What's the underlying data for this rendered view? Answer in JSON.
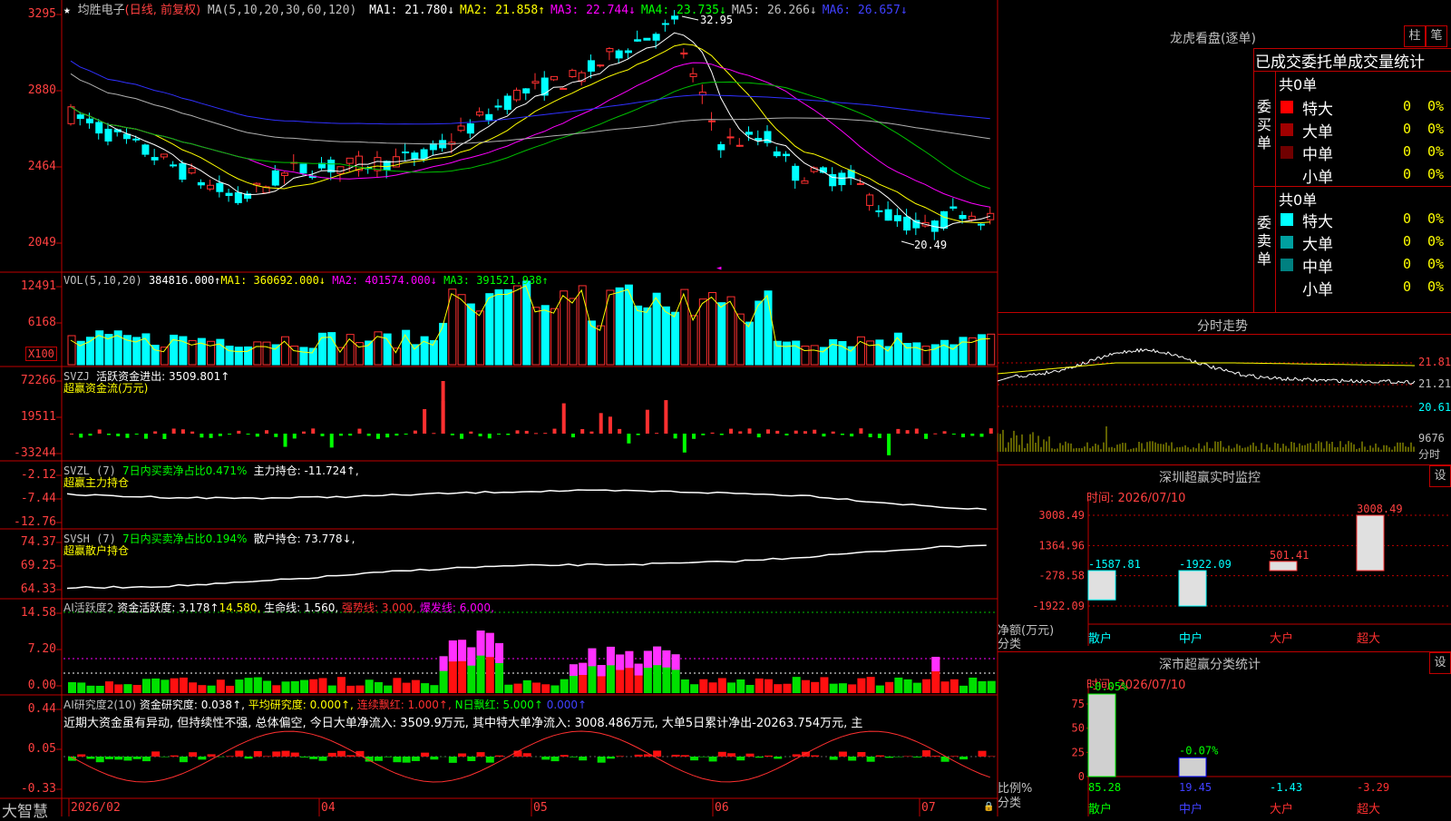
{
  "title_bar": {
    "star": "★",
    "stock_name": "均胜电子",
    "period": "(日线, 前复权)",
    "ma_label": "MA(5,10,20,30,60,120)",
    "ma": [
      {
        "label": "MA1: 21.780↓",
        "color": "#ffffff"
      },
      {
        "label": "MA2: 21.858↑",
        "color": "#ffff00"
      },
      {
        "label": "MA3: 22.744↓",
        "color": "#ff00ff"
      },
      {
        "label": "MA4: 23.735↓",
        "color": "#00ff00"
      },
      {
        "label": "MA5: 26.266↓",
        "color": "#c0c0c0"
      },
      {
        "label": "MA6: 26.657↓",
        "color": "#4040ff"
      }
    ]
  },
  "price_panel": {
    "y_labels": [
      "3295",
      "2880",
      "2464",
      "2049"
    ],
    "high_label": "32.95",
    "low_label": "20.49"
  },
  "vol_panel": {
    "title": "VOL(5,10,20)",
    "value": "384816.000↑",
    "ma1": "MA1: 360692.000↓",
    "ma2": "MA2: 401574.000↓",
    "ma3": "MA3: 391521.938↑",
    "y_labels": [
      "12491",
      "6168"
    ],
    "unit": "X100"
  },
  "svzj_panel": {
    "title": "SVZJ",
    "text": "活跃资金进出: 3509.801↑",
    "sub": "超赢资金流(万元)",
    "y_labels": [
      "72266",
      "19511",
      "-33244"
    ]
  },
  "svzl_panel": {
    "title": "SVZL (7)",
    "text1": "7日内买卖净占比0.471%",
    "text2": "主力持仓: -11.724↑,",
    "sub": "超赢主力持仓",
    "y_labels": [
      "-2.12",
      "-7.44",
      "-12.76"
    ]
  },
  "svsh_panel": {
    "title": "SVSH (7)",
    "text1": "7日内买卖净占比0.194%",
    "text2": "散户持仓: 73.778↓,",
    "sub": "超赢散户持仓",
    "y_labels": [
      "74.37",
      "69.25",
      "64.33"
    ]
  },
  "ai_active_panel": {
    "title": "AI活跃度2",
    "t1": "资金活跃度: 3.178↑",
    "t2": "14.580,",
    "t3": "生命线: 1.560,",
    "t4": "强势线: 3.000,",
    "t5": "爆发线: 6.000,",
    "y_labels": [
      "14.58",
      "7.20",
      "0.00"
    ]
  },
  "ai_research_panel": {
    "title": "AI研究度2(10)",
    "t1": "资金研究度: 0.038↑,",
    "t2": "平均研究度: 0.000↑,",
    "t3": "连续飘红: 1.000↑,",
    "t4": "N日飘红: 5.000↑",
    "t5": "0.000↑",
    "comment": "近期大资金虽有异动, 但持续性不强, 总体偏空, 今日大单净流入: 3509.9万元, 其中特大单净流入: 3008.486万元, 大单5日累计净出-20263.754万元, 主",
    "y_labels": [
      "0.44",
      "0.05",
      "-0.33"
    ]
  },
  "x_axis": {
    "brand": "大智慧",
    "labels": [
      "2026/02",
      "04",
      "05",
      "06",
      "07"
    ]
  },
  "dragon_tiger": {
    "title": "龙虎看盘(逐单)",
    "btn_bar": "柱",
    "btn_pen": "笔",
    "tab_label": "已成交委托单成交量统计",
    "buy_side": "委买单",
    "sell_side": "委卖单",
    "buy_total": "共0单",
    "sell_total": "共0单",
    "buy_rows": [
      {
        "label": "特大",
        "count": "0",
        "pct": "0%",
        "color": "#ff0000"
      },
      {
        "label": "大单",
        "count": "0",
        "pct": "0%",
        "color": "#a00000"
      },
      {
        "label": "中单",
        "count": "0",
        "pct": "0%",
        "color": "#700000"
      },
      {
        "label": "小单",
        "count": "0",
        "pct": "0%",
        "color": "#000000"
      }
    ],
    "sell_rows": [
      {
        "label": "特大",
        "count": "0",
        "pct": "0%",
        "color": "#00ffff"
      },
      {
        "label": "大单",
        "count": "0",
        "pct": "0%",
        "color": "#00a0a0"
      },
      {
        "label": "中单",
        "count": "0",
        "pct": "0%",
        "color": "#008080"
      },
      {
        "label": "小单",
        "count": "0",
        "pct": "0%",
        "color": "#000000"
      }
    ]
  },
  "intraday": {
    "title": "分时走势",
    "price_labels": [
      "21.81",
      "21.21",
      "20.61"
    ],
    "vol_labels": [
      "9676",
      "分时"
    ]
  },
  "sz_monitor": {
    "title": "深圳超赢实时监控",
    "btn": "设",
    "time": "时间: 2026/07/10",
    "y_labels": [
      "3008.49",
      "1364.96",
      "-278.58",
      "-1922.09"
    ],
    "unit_label": "净额(万元)",
    "cat_label": "分类",
    "categories": [
      "散户",
      "中户",
      "大户",
      "超大"
    ],
    "values": [
      -1587.81,
      -1922.09,
      501.41,
      3008.49
    ],
    "value_labels": [
      "-1587.81",
      "-1922.09",
      "501.41",
      "3008.49"
    ]
  },
  "sz_class": {
    "title": "深市超赢分类统计",
    "btn": "设",
    "time": "时间: 2026/07/10",
    "y_labels": [
      "75",
      "50",
      "25",
      "0"
    ],
    "ratio_label": "比例%",
    "cat_label": "分类",
    "categories": [
      "散户",
      "中户",
      "大户",
      "超大"
    ],
    "values": [
      85.28,
      19.45,
      -1.43,
      -3.29
    ],
    "value_labels": [
      "85.28",
      "19.45",
      "-1.43",
      "-3.29"
    ],
    "change_labels": [
      "-0.05%",
      "-0.07%"
    ]
  }
}
